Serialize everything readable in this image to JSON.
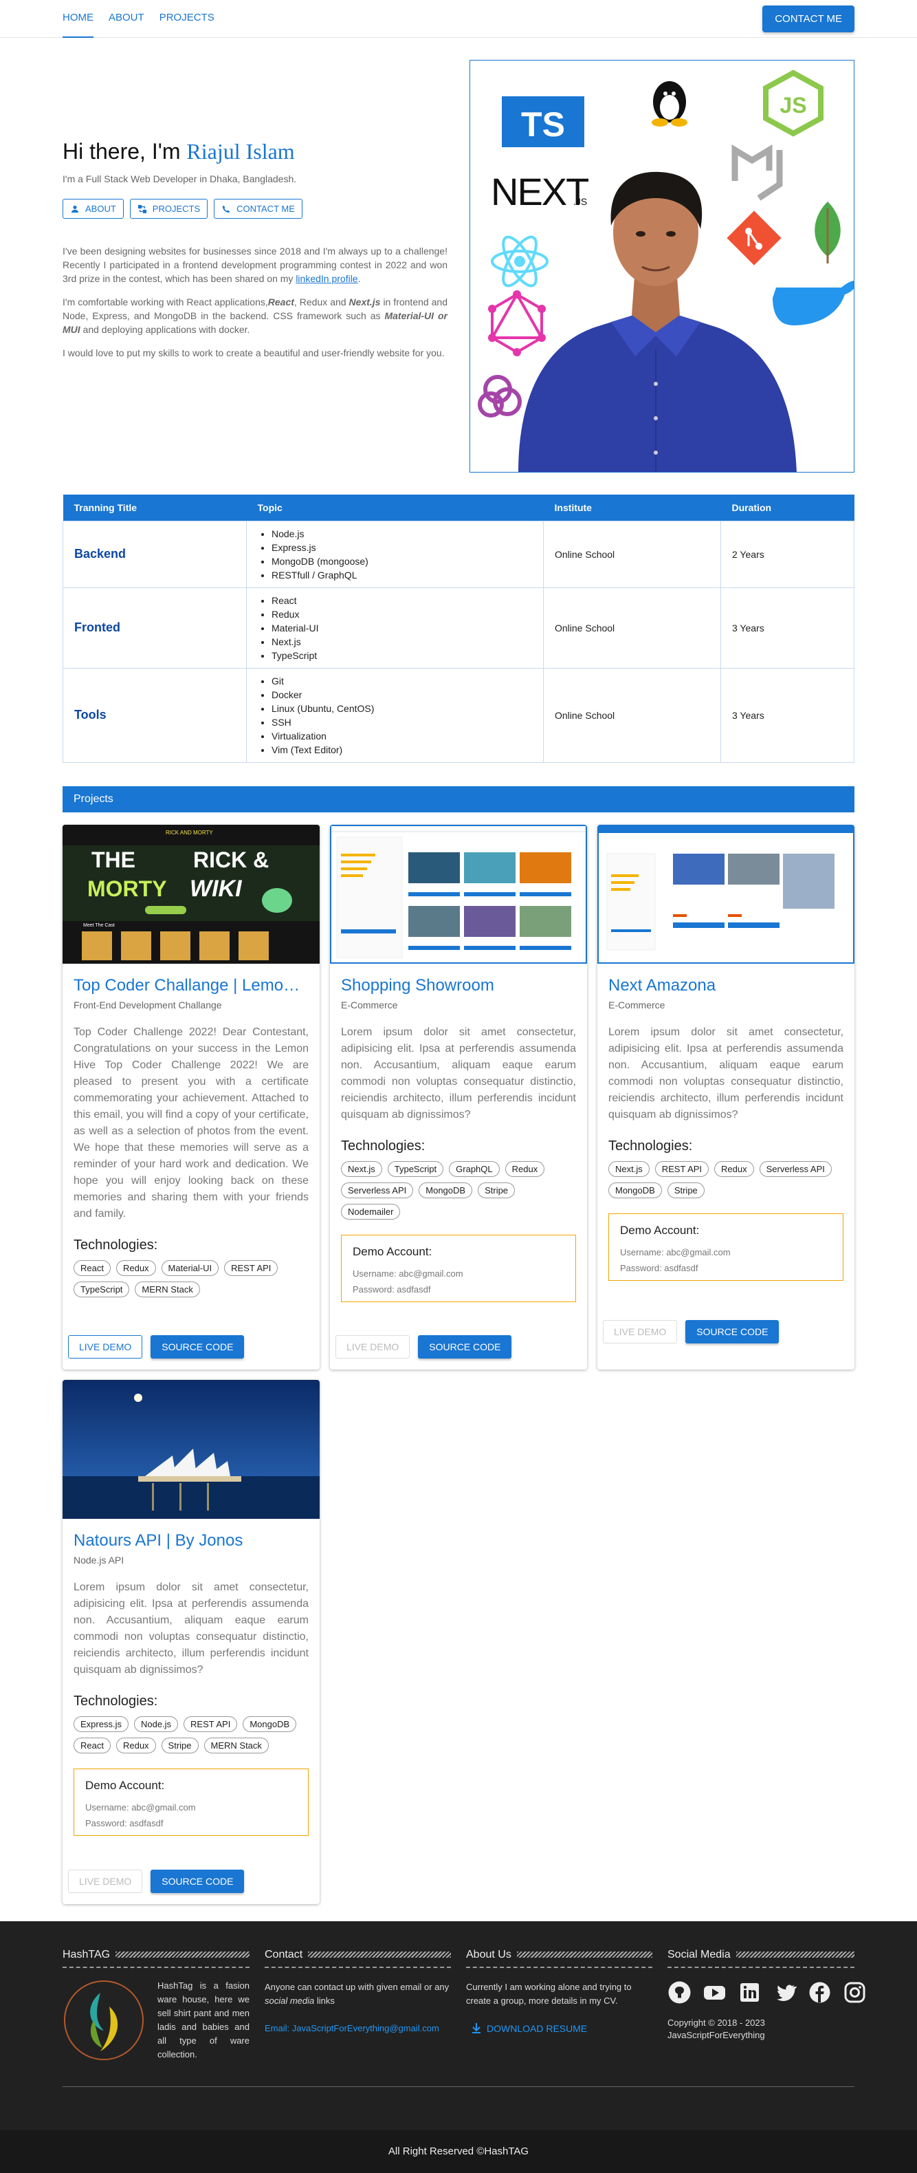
{
  "nav": {
    "items": [
      {
        "label": "HOME"
      },
      {
        "label": "ABOUT"
      },
      {
        "label": "PROJECTS"
      }
    ],
    "contact": "CONTACT ME"
  },
  "hero": {
    "greeting": "Hi there, I'm",
    "name": "Riajul Islam",
    "subtitle": "I'm a Full Stack Web Developer in Dhaka, Bangladesh.",
    "buttons": {
      "about": "ABOUT",
      "projects": "PROJECTS",
      "contact": "CONTACT ME"
    },
    "p1a": "I've been designing websites for businesses since 2018 and I'm always up to a challenge! Recently I participated in a frontend development programming contest in 2022 and won 3rd prize in the contest, which has been shared on my ",
    "p1link": "linkedIn profile",
    "p1b": ".",
    "p2a": "I'm comfortable working with React applications,",
    "p2b": "React",
    "p2c": ", Redux and ",
    "p2d": "Next.js",
    "p2e": " in frontend and Node, Express, and MongoDB in the backend. CSS framework such as ",
    "p2f": "Material-UI or MUI",
    "p2g": " and deploying applications with docker.",
    "p3": "I would love to put my skills to work to create a beautiful and user-friendly website for you.",
    "logos": {
      "ts": "TS",
      "next": "NEXT",
      "nextjs": ".JS"
    }
  },
  "training": {
    "headers": [
      "Tranning Title",
      "Topic",
      "Institute",
      "Duration"
    ],
    "rows": [
      {
        "title": "Backend",
        "topics": [
          "Node.js",
          "Express.js",
          "MongoDB (mongoose)",
          "RESTfull / GraphQL"
        ],
        "institute": "Online School",
        "duration": "2 Years"
      },
      {
        "title": "Fronted",
        "topics": [
          "React",
          "Redux",
          "Material-UI",
          "Next.js",
          "TypeScript"
        ],
        "institute": "Online School",
        "duration": "3 Years"
      },
      {
        "title": "Tools",
        "topics": [
          "Git",
          "Docker",
          "Linux (Ubuntu, CentOS)",
          "SSH",
          "Virtualization",
          "Vim (Text Editor)"
        ],
        "institute": "Online School",
        "duration": "3 Years"
      }
    ]
  },
  "projects": {
    "heading": "Projects",
    "tech_label": "Technologies:",
    "demo_title": "Demo Account:",
    "demo_user": "Username: abc@gmail.com",
    "demo_pass": "Password: asdfasdf",
    "live": "LIVE DEMO",
    "source": "SOURCE CODE",
    "lorem": "Lorem ipsum dolor sit amet consectetur, adipisicing elit. Ipsa at perferendis assumenda non. Accusantium, aliquam eaque earum commodi non voluptas consequatur distinctio, reiciendis architecto, illum perferendis incidunt quisquam ab dignissimos?",
    "items": [
      {
        "title": "Top Coder Challange | Lemon Hive",
        "category": "Front-End Development Challange",
        "desc": "Top Coder Challenge 2022! Dear Contestant, Congratulations on your success in the Lemon Hive Top Coder Challenge 2022! We are pleased to present you with a certificate commemorating your achievement. Attached to this email, you will find a copy of your certificate, as well as a selection of photos from the event. We hope that these memories will serve as a reminder of your hard work and dedication. We hope you will enjoy looking back on these memories and sharing them with your friends and family.",
        "tech": [
          "React",
          "Redux",
          "Material-UI",
          "REST API",
          "TypeScript",
          "MERN Stack"
        ],
        "thumb": {
          "l1": "THE",
          "l2": "RICK &",
          "l3": "MORTY",
          "l4": "WIKI",
          "top": "RICK AND MORTY",
          "meet": "Meet The Cast"
        }
      },
      {
        "title": "Shopping Showroom",
        "category": "E-Commerce",
        "tech": [
          "Next.js",
          "TypeScript",
          "GraphQL",
          "Redux",
          "Serverless API",
          "MongoDB",
          "Stripe",
          "Nodemailer"
        ]
      },
      {
        "title": "Next Amazona",
        "category": "E-Commerce",
        "tech": [
          "Next.js",
          "REST API",
          "Redux",
          "Serverless API",
          "MongoDB",
          "Stripe"
        ]
      },
      {
        "title": "Natours API | By Jonos",
        "category": "Node.js API",
        "tech": [
          "Express.js",
          "Node.js",
          "REST API",
          "MongoDB",
          "React",
          "Redux",
          "Stripe",
          "MERN Stack"
        ]
      }
    ]
  },
  "footer": {
    "cols": [
      {
        "title": "HashTAG",
        "text": "HashTag is a fasion ware house, here we sell shirt pant and men ladis and babies and all type of ware collection."
      },
      {
        "title": "Contact",
        "text1": "Anyone can contact up with given email or any ",
        "text1i": "social media",
        "text1b": " links",
        "email": "Email: JavaScriptForEverything@gmail.com"
      },
      {
        "title": "About Us",
        "text": "Currently I am working alone and trying to create a group, more details in my CV.",
        "download": "DOWNLOAD RESUME"
      },
      {
        "title": "Social Media",
        "copy1": "Copyright © 2018 - 2023",
        "copy2": "JavaScriptForEverything"
      }
    ],
    "bottom": "All Right Reserved ©HashTAG"
  },
  "colors": {
    "primary": "#1976d2",
    "footer": "#212121",
    "demo_border": "#f0a500"
  }
}
